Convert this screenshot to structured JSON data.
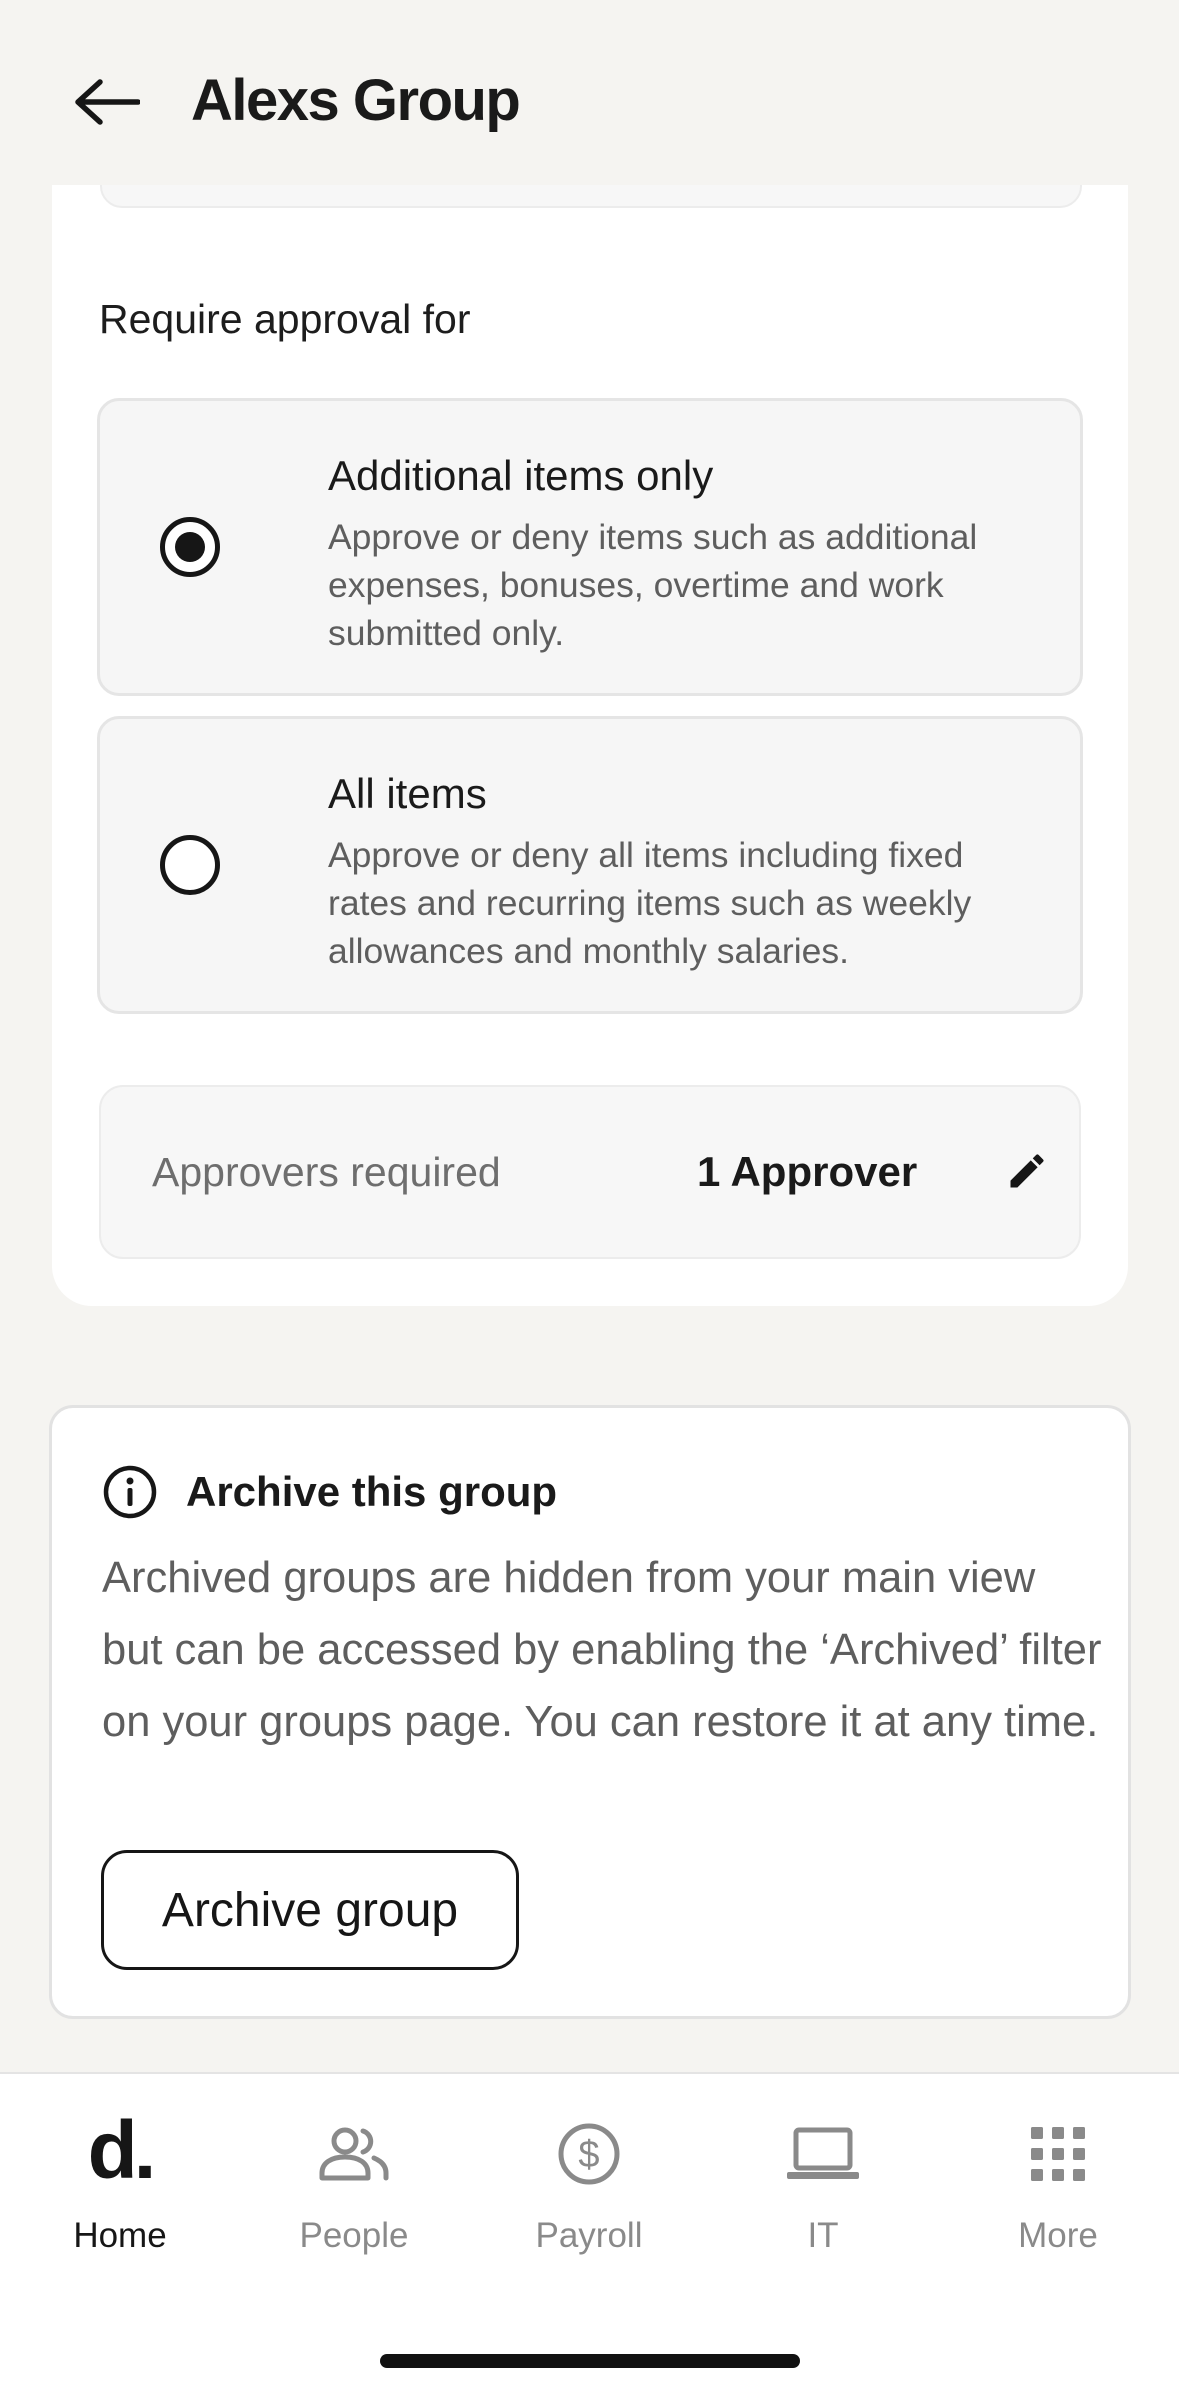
{
  "header": {
    "title": "Alexs Group"
  },
  "approval": {
    "section_label": "Require approval for",
    "options": [
      {
        "title": "Additional items only",
        "description": "Approve or deny items such as additional expenses, bonuses, overtime and work submitted only.",
        "selected": true
      },
      {
        "title": "All items",
        "description": "Approve or deny all items including fixed rates and recurring items such as weekly allowances and monthly salaries.",
        "selected": false
      }
    ],
    "approvers_label": "Approvers required",
    "approvers_value": "1 Approver"
  },
  "archive": {
    "title": "Archive this group",
    "description": "Archived groups are hidden from your main view but can be accessed by enabling the ‘Archived’ filter on your groups page. You can restore it at any time.",
    "button_label": "Archive group"
  },
  "nav": {
    "items": [
      {
        "label": "Home",
        "icon": "home-logo-icon",
        "active": true,
        "logo_text": "d."
      },
      {
        "label": "People",
        "icon": "people-icon",
        "active": false
      },
      {
        "label": "Payroll",
        "icon": "dollar-icon",
        "active": false
      },
      {
        "label": "IT",
        "icon": "laptop-icon",
        "active": false
      },
      {
        "label": "More",
        "icon": "grid-icon",
        "active": false
      }
    ]
  },
  "colors": {
    "background": "#f5f4f1",
    "card": "#ffffff",
    "text_primary": "#1a1a1a",
    "text_secondary": "#5e5e5e",
    "nav_inactive": "#8a8a8a"
  }
}
